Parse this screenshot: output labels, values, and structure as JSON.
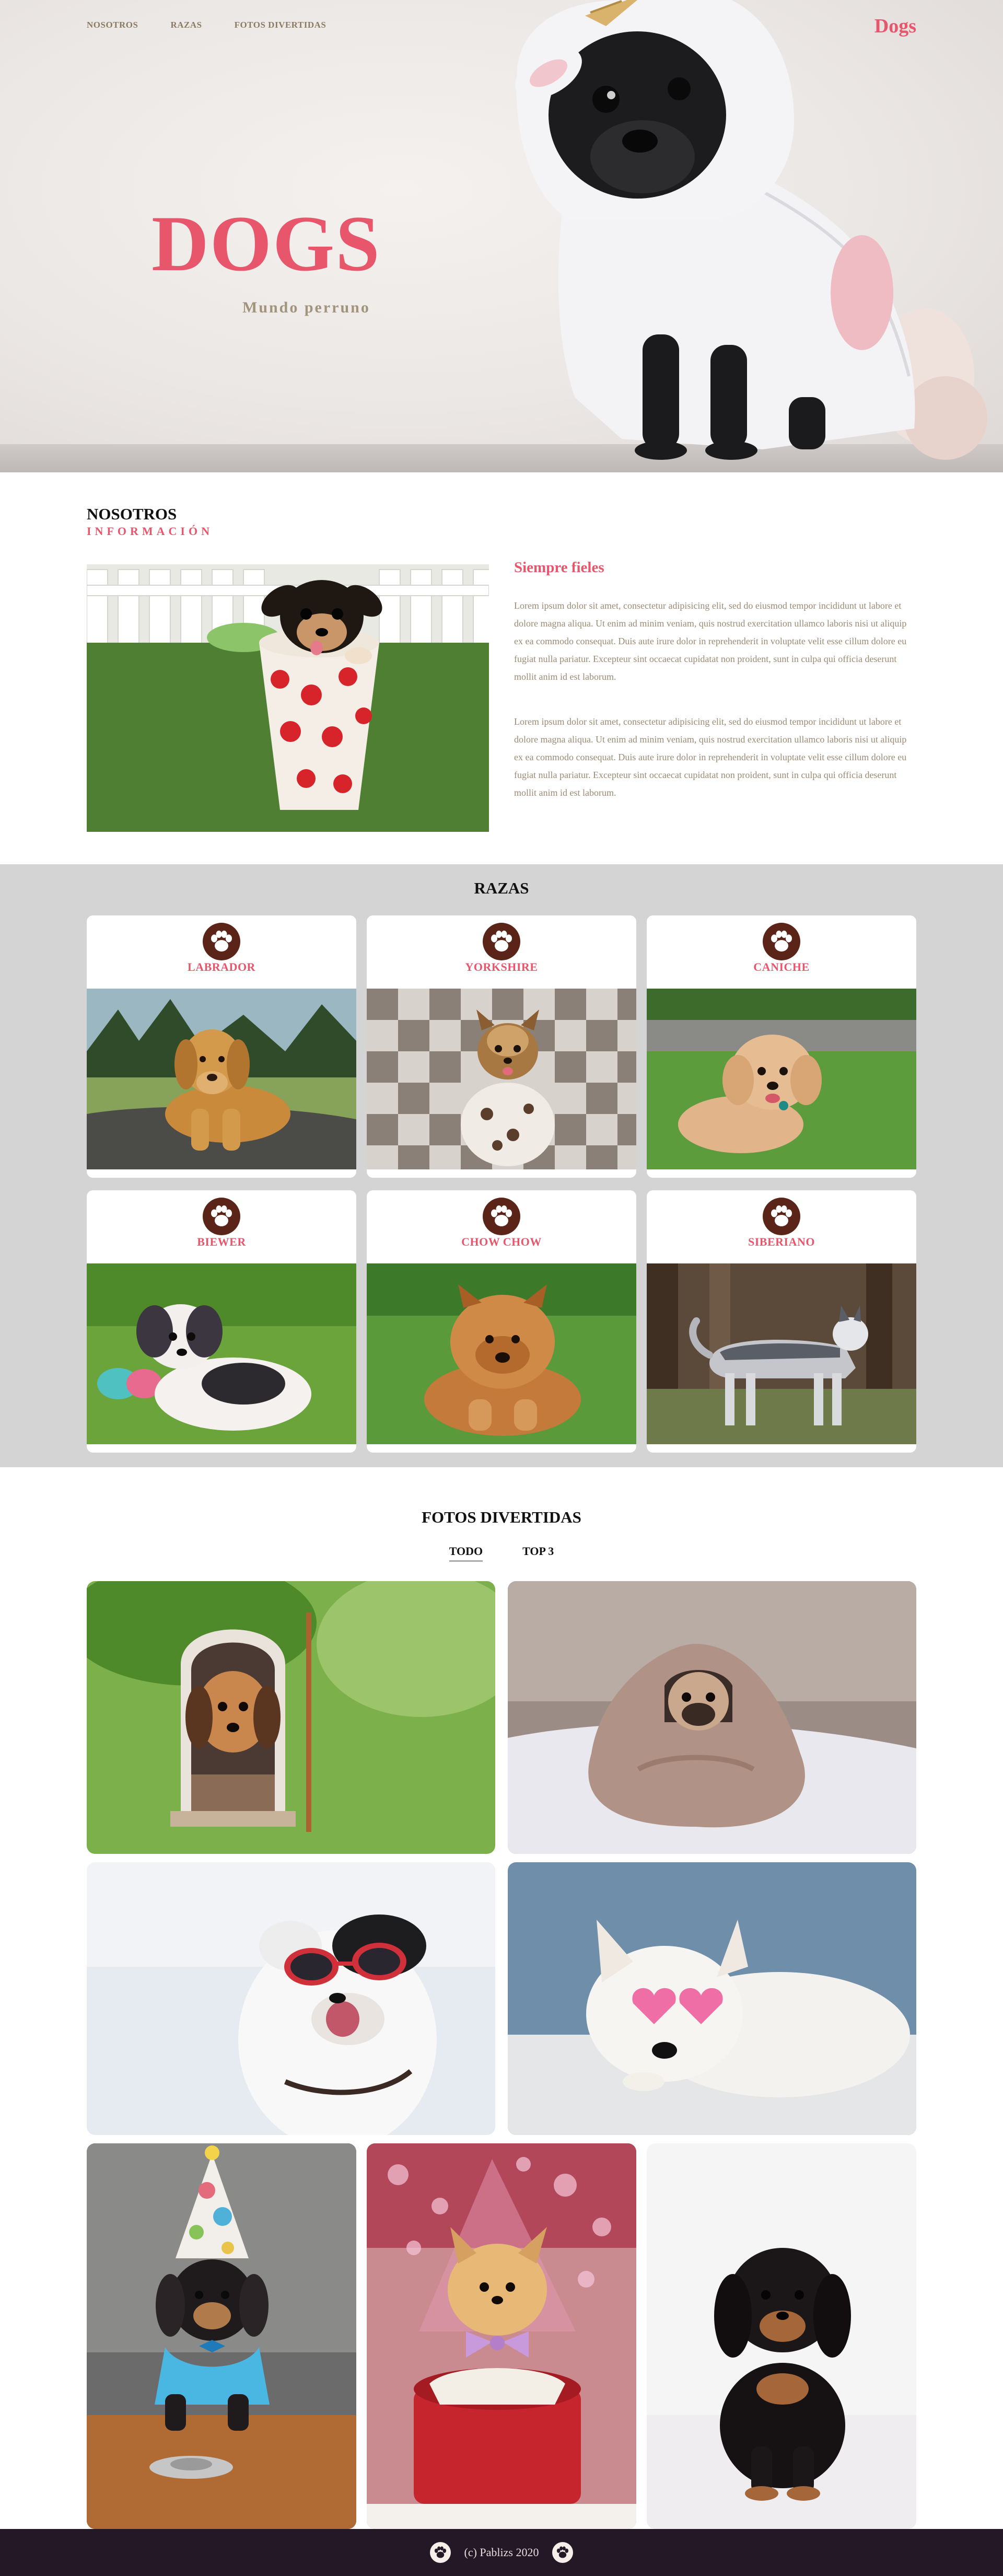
{
  "colors": {
    "accent": "#e8566c",
    "nav_text": "#8a7a62",
    "paw_circle": "#5a2418",
    "breeds_bg": "#d4d4d4",
    "footer_bg": "#241726"
  },
  "nav": {
    "items": [
      "NOSOTROS",
      "RAZAS",
      "FOTOS DIVERTIDAS"
    ],
    "brand": "Dogs"
  },
  "hero": {
    "title": "DOGS",
    "subtitle": "Mundo perruno"
  },
  "about": {
    "title": "NOSOTROS",
    "kicker": "INFORMACIÓN",
    "heading": "Siempre fieles",
    "paragraphs": [
      "Lorem ipsum dolor sit amet, consectetur adipisicing elit, sed do eiusmod tempor incididunt ut labore et dolore magna aliqua. Ut enim ad minim veniam, quis nostrud exercitation ullamco laboris nisi ut aliquip ex ea commodo consequat. Duis aute irure dolor in reprehenderit in voluptate velit esse cillum dolore eu fugiat nulla pariatur. Excepteur sint occaecat cupidatat non proident, sunt in culpa qui officia deserunt mollit anim id est laborum.",
      "Lorem ipsum dolor sit amet, consectetur adipisicing elit, sed do eiusmod tempor incididunt ut labore et dolore magna aliqua. Ut enim ad minim veniam, quis nostrud exercitation ullamco laboris nisi ut aliquip ex ea commodo consequat. Duis aute irure dolor in reprehenderit in voluptate velit esse cillum dolore eu fugiat nulla pariatur. Excepteur sint occaecat cupidatat non proident, sunt in culpa qui officia deserunt mollit anim id est laborum."
    ]
  },
  "breeds": {
    "title": "RAZAS",
    "items": [
      {
        "name": "LABRADOR",
        "icon": "paw-icon"
      },
      {
        "name": "YORKSHIRE",
        "icon": "paw-icon"
      },
      {
        "name": "CANICHE",
        "icon": "paw-icon"
      },
      {
        "name": "BIEWER",
        "icon": "paw-icon"
      },
      {
        "name": "CHOW CHOW",
        "icon": "paw-icon"
      },
      {
        "name": "SIBERIANO",
        "icon": "paw-icon"
      }
    ]
  },
  "photos": {
    "title": "FOTOS DIVERTIDAS",
    "tabs": [
      "TODO",
      "TOP 3"
    ],
    "active_tab": "TODO"
  },
  "footer": {
    "text": "(c) Pablizs 2020",
    "icon": "paw-icon"
  }
}
